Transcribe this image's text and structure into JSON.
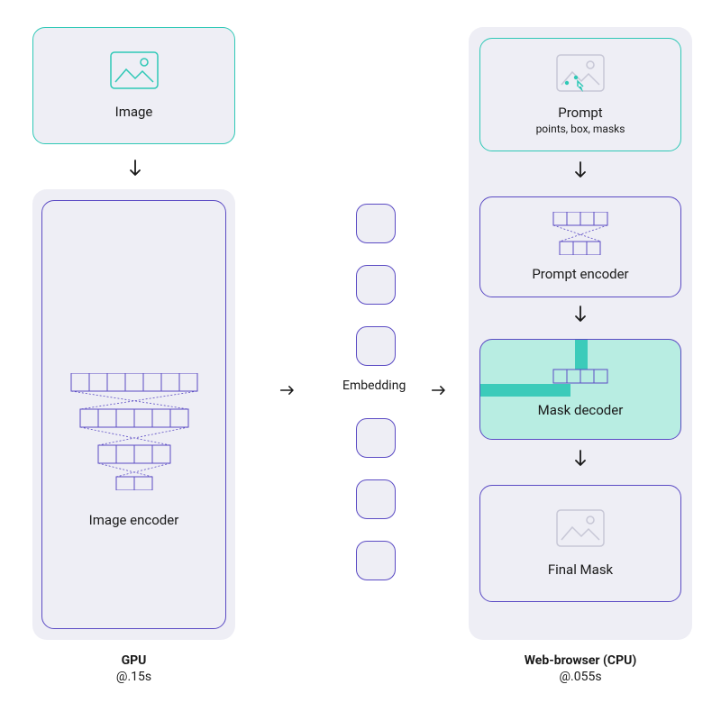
{
  "left": {
    "image_box_label": "Image",
    "encoder_box_label": "Image encoder",
    "caption_title": "GPU",
    "caption_time": "@.15s"
  },
  "center": {
    "embedding_label": "Embedding"
  },
  "right": {
    "prompt_box_label": "Prompt",
    "prompt_box_sub": "points, box, masks",
    "prompt_encoder_label": "Prompt encoder",
    "mask_decoder_label": "Mask decoder",
    "final_mask_label": "Final Mask",
    "caption_title": "Web-browser (CPU)",
    "caption_time": "@.055s"
  }
}
